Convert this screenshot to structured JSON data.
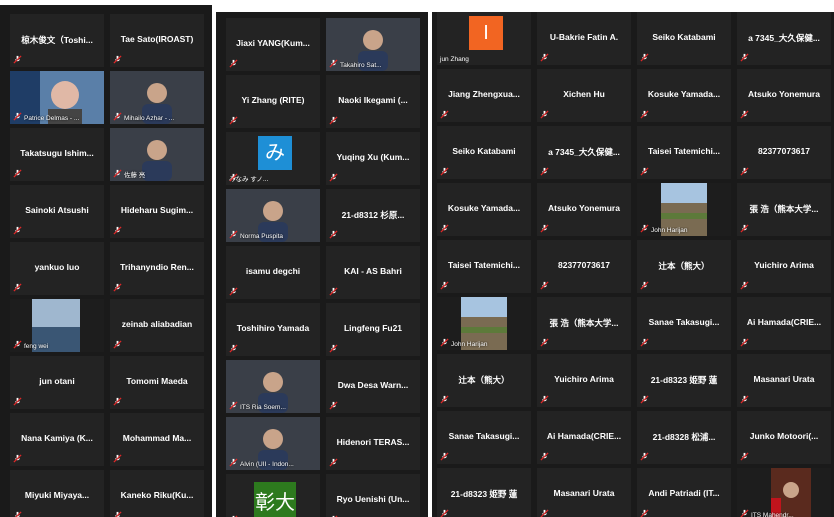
{
  "panel1": {
    "tiles": [
      {
        "name": "椋木俊文（Toshi...",
        "type": "text"
      },
      {
        "name": "Tae Sato(IROAST)",
        "type": "text"
      },
      {
        "name": "Patrice Delmas - ...",
        "type": "video"
      },
      {
        "name": "Mihailo Azhar - ...",
        "type": "video"
      },
      {
        "name": "Takatsugu Ishim...",
        "type": "text"
      },
      {
        "name": "佐藤 亮",
        "type": "video"
      },
      {
        "name": "Sainoki Atsushi",
        "type": "text"
      },
      {
        "name": "Hideharu Sugim...",
        "type": "text"
      },
      {
        "name": "yankuo luo",
        "type": "text"
      },
      {
        "name": "Trihanyndio Ren...",
        "type": "text"
      },
      {
        "name": "feng wei",
        "type": "video"
      },
      {
        "name": "zeinab aliabadian",
        "type": "text"
      },
      {
        "name": "jun otani",
        "type": "text"
      },
      {
        "name": "Tomomi Maeda",
        "type": "text"
      },
      {
        "name": "Nana Kamiya (K...",
        "type": "text"
      },
      {
        "name": "Mohammad Ma...",
        "type": "text"
      },
      {
        "name": "Miyuki Miyaya...",
        "type": "text"
      },
      {
        "name": "Kaneko Riku(Ku...",
        "type": "text"
      }
    ]
  },
  "panel2": {
    "tiles": [
      {
        "name": "Jiaxi YANG(Kum...",
        "type": "text"
      },
      {
        "name": "Takahiro Sat...",
        "type": "video"
      },
      {
        "name": "Yi Zhang (RITE)",
        "type": "text"
      },
      {
        "name": "Naoki Ikegami (...",
        "type": "text"
      },
      {
        "name": "みなみ すノ...",
        "type": "avatar",
        "letter": "み"
      },
      {
        "name": "Yuqing Xu (Kum...",
        "type": "text"
      },
      {
        "name": "Norma Puspita",
        "type": "video"
      },
      {
        "name": "21-d8312 杉原...",
        "type": "text"
      },
      {
        "name": "isamu degchi",
        "type": "text"
      },
      {
        "name": "KAI - AS Bahri",
        "type": "text"
      },
      {
        "name": "Toshihiro Yamada",
        "type": "text"
      },
      {
        "name": "Lingfeng Fu21",
        "type": "text"
      },
      {
        "name": "ITS Ria Soem...",
        "type": "video"
      },
      {
        "name": "Dwa Desa Warn...",
        "type": "text"
      },
      {
        "name": "Alvin (UII - Indon...",
        "type": "video"
      },
      {
        "name": "Hidenori TERAS...",
        "type": "text"
      },
      {
        "name": "",
        "type": "avatar",
        "letter": "彰大"
      },
      {
        "name": "Ryo Uenishi (Un...",
        "type": "text"
      }
    ]
  },
  "panel3": {
    "tiles": [
      {
        "name": "jun Zhang",
        "type": "avatar",
        "letter": "I"
      },
      {
        "name": "U-Bakrie Fatin A.",
        "type": "text"
      },
      {
        "name": "Seiko Katabami",
        "type": "text"
      },
      {
        "name": "a 7345_大久保健...",
        "type": "text"
      },
      {
        "name": "Jiang Zhengxua...",
        "type": "text"
      },
      {
        "name": "Xichen Hu",
        "type": "text"
      },
      {
        "name": "Kosuke Yamada...",
        "type": "text"
      },
      {
        "name": "Atsuko Yonemura",
        "type": "text"
      },
      {
        "name": "Seiko Katabami",
        "type": "text"
      },
      {
        "name": "a 7345_大久保健...",
        "type": "text"
      },
      {
        "name": "Taisei Tatemichi...",
        "type": "text"
      },
      {
        "name": "82377073617",
        "type": "text"
      },
      {
        "name": "Kosuke Yamada...",
        "type": "text"
      },
      {
        "name": "Atsuko Yonemura",
        "type": "text"
      },
      {
        "name": "John Harijan",
        "type": "video"
      },
      {
        "name": "張 浩（熊本大学...",
        "type": "text"
      },
      {
        "name": "Taisei Tatemichi...",
        "type": "text"
      },
      {
        "name": "82377073617",
        "type": "text"
      },
      {
        "name": "辻本（熊大）",
        "type": "text"
      },
      {
        "name": "Yuichiro Arima",
        "type": "text"
      },
      {
        "name": "John Harijan",
        "type": "video"
      },
      {
        "name": "張 浩（熊本大学...",
        "type": "text"
      },
      {
        "name": "Sanae Takasugi...",
        "type": "text"
      },
      {
        "name": "Ai Hamada(CRIE...",
        "type": "text"
      },
      {
        "name": "辻本（熊大）",
        "type": "text"
      },
      {
        "name": "Yuichiro Arima",
        "type": "text"
      },
      {
        "name": "21-d8323 姫野 蓮",
        "type": "text"
      },
      {
        "name": "Masanari Urata",
        "type": "text"
      },
      {
        "name": "Sanae Takasugi...",
        "type": "text"
      },
      {
        "name": "Ai Hamada(CRIE...",
        "type": "text"
      },
      {
        "name": "21-d8328 松浦...",
        "type": "text"
      },
      {
        "name": "Junko Motoori(...",
        "type": "text"
      },
      {
        "name": "21-d8323 姫野 蓮",
        "type": "text"
      },
      {
        "name": "Masanari Urata",
        "type": "text"
      },
      {
        "name": "Andi Patriadi (IT...",
        "type": "text"
      },
      {
        "name": "ITS Mahendr...",
        "type": "video"
      }
    ]
  },
  "colors": {
    "tile_bg": "#232323",
    "panel_bg": "#1a1a1a",
    "mute_red": "#e02828",
    "active_speaker": "#b8e04a",
    "avatar_blue": "#1e8fd6",
    "avatar_orange": "#f26522",
    "avatar_green": "#2d7a1e"
  }
}
